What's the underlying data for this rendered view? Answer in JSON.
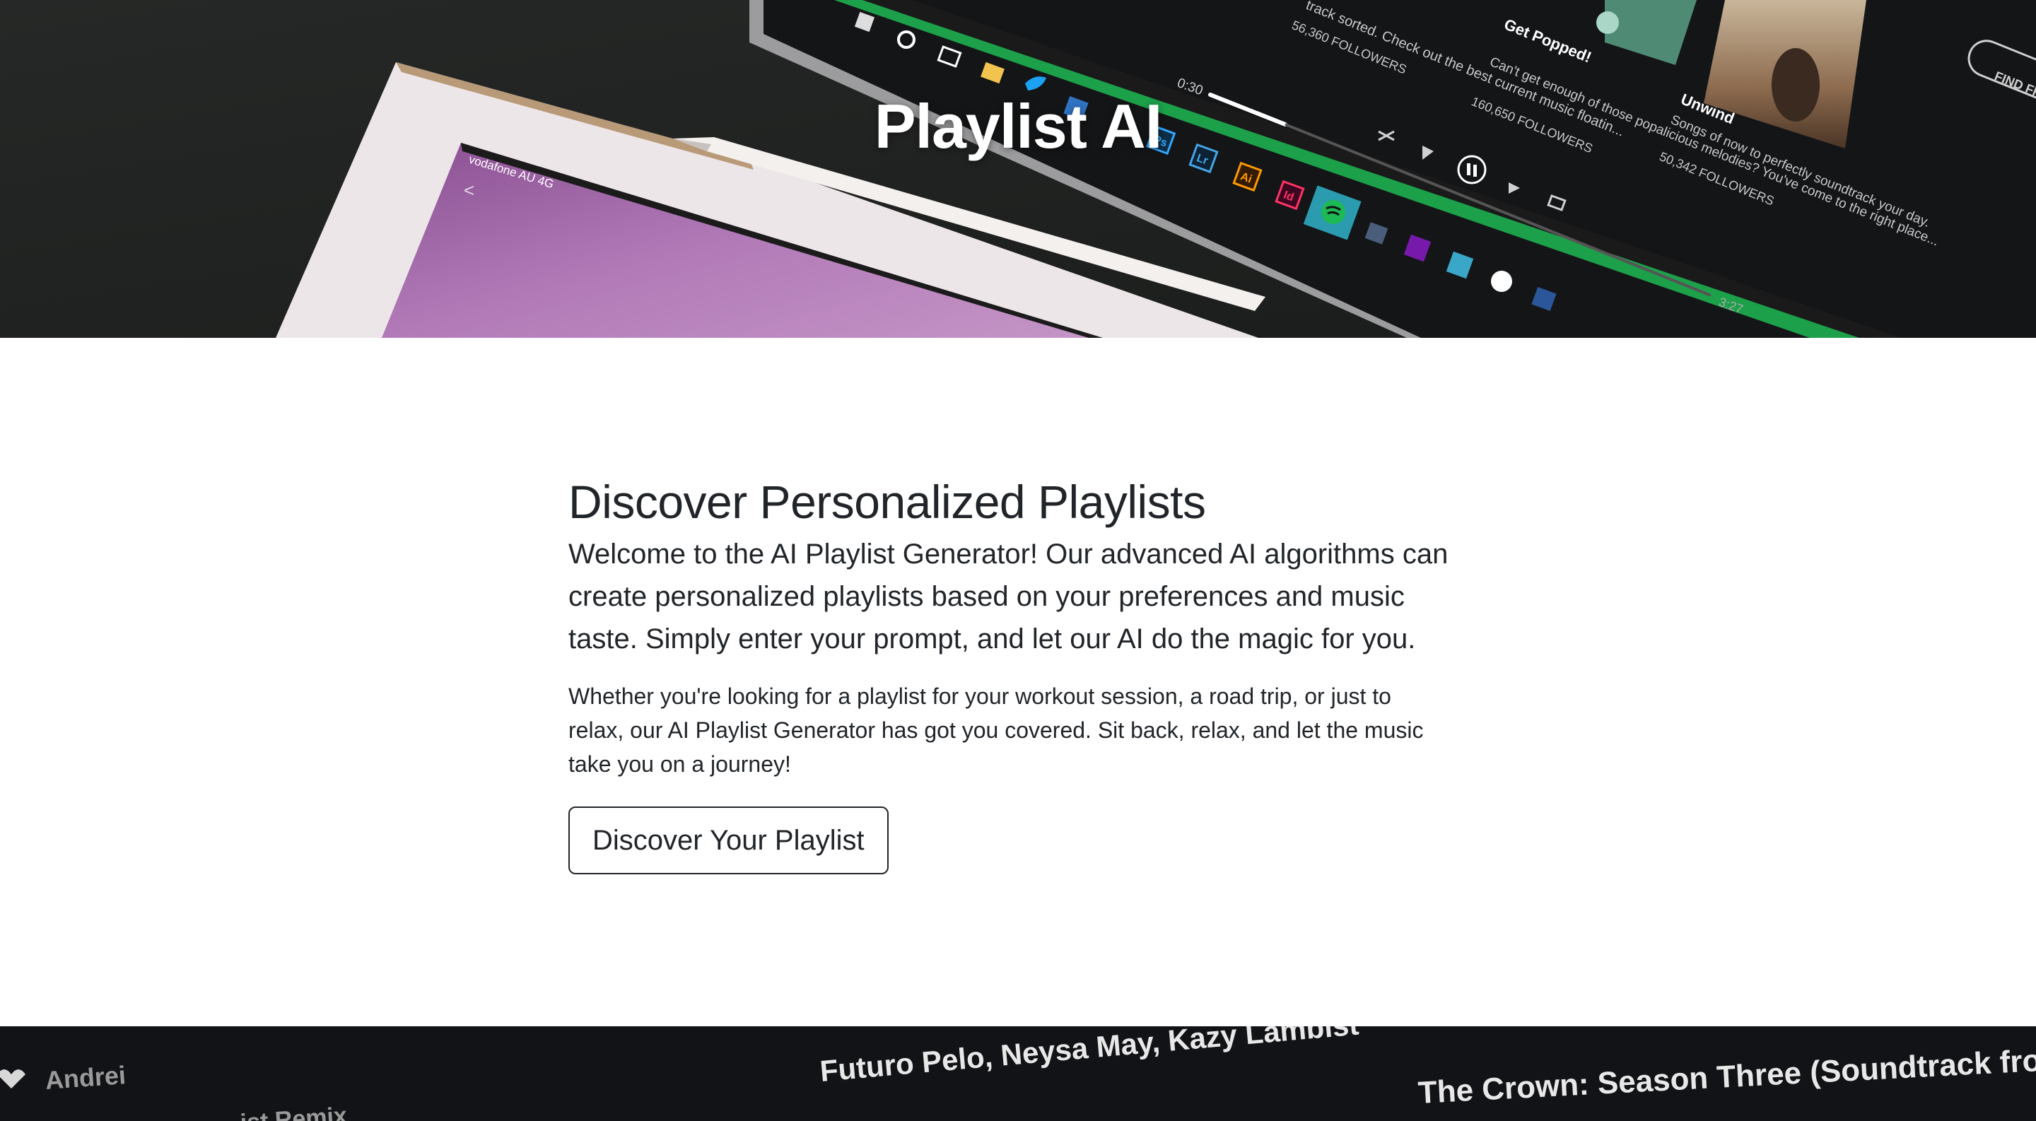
{
  "hero": {
    "title": "Playlist AI",
    "screen_text": {
      "workday": "track sorted. Check out the best current music floatin...",
      "followers_1": "56,360 FOLLOWERS",
      "card_title_1": "Get Popped!",
      "card_desc_1": "Can't get enough of those popalicious melodies? You've come to the right place...",
      "followers_2": "160,650 FOLLOWERS",
      "card_title_2": "Unwind",
      "card_desc_2": "Songs of now to perfectly soundtrack your day.",
      "followers_3": "50,342 FOLLOWERS",
      "time_elapsed": "0:30",
      "time_total": "3:27",
      "find_button": "FIND FR",
      "tablet_status": "vodafone AU   4G"
    },
    "dock_icons": [
      "windows-icon",
      "cortana-icon",
      "task-view-icon",
      "file-explorer-icon",
      "twitter-icon",
      "outlook-icon",
      "photoshop-icon",
      "lightroom-icon",
      "illustrator-icon",
      "indesign-icon",
      "spotify-icon",
      "onenote-icon",
      "camera-icon",
      "info-icon",
      "word-icon"
    ],
    "player_icons": [
      "shuffle-icon",
      "previous-icon",
      "pause-icon",
      "next-icon",
      "repeat-icon"
    ]
  },
  "main": {
    "heading": "Discover Personalized Playlists",
    "lead": "Welcome to the AI Playlist Generator! Our advanced AI algorithms can create personalized playlists based on your preferences and music taste. Simply enter your prompt, and let our AI do the magic for you.",
    "body": "Whether you're looking for a playlist for your workout session, a road trip, or just to relax, our AI Playlist Generator has got you covered. Sit back, relax, and let the music take you on a journey!",
    "cta_label": "Discover Your Playlist"
  },
  "banner": {
    "text_andrei": "Andrei",
    "text_remix": "ist Remix",
    "text_artists": "Futuro Pelo, Neysa May, Kazy Lambist",
    "text_crown": "The Crown: Season Three (Soundtrack fro..."
  },
  "colors": {
    "spotify_green": "#1db954",
    "hero_bg": "#1f2120",
    "text": "#212529",
    "tablet_purple": "#a46cab"
  }
}
